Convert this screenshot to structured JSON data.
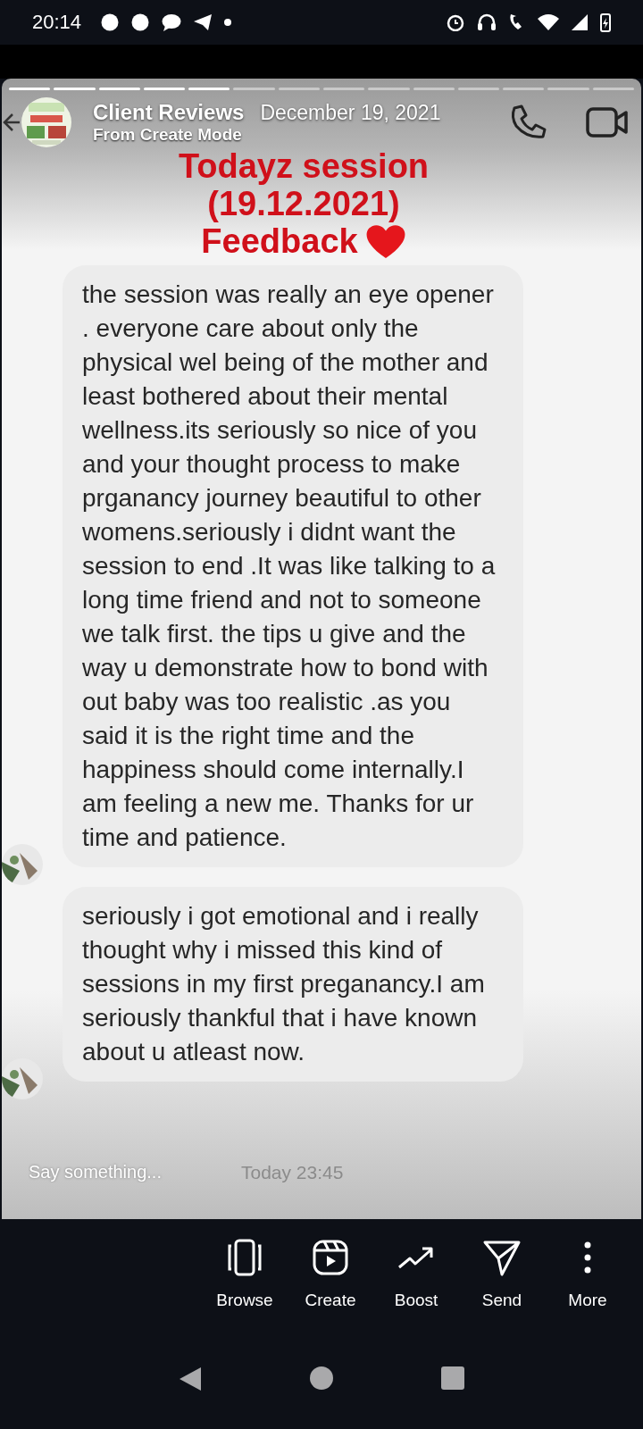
{
  "status_bar": {
    "time": "20:14"
  },
  "story_progress": [
    {
      "viewed": true
    },
    {
      "viewed": true
    },
    {
      "viewed": true
    },
    {
      "viewed": true
    },
    {
      "viewed": true
    },
    {
      "viewed": false
    },
    {
      "viewed": false
    },
    {
      "viewed": false
    },
    {
      "viewed": false
    },
    {
      "viewed": false
    },
    {
      "viewed": false
    },
    {
      "viewed": false
    },
    {
      "viewed": false
    },
    {
      "viewed": false
    }
  ],
  "chat_header": {
    "name": "Client Reviews",
    "subtitle": "From Create Mode",
    "date": "December 19, 2021"
  },
  "sticker": {
    "lines": [
      "Todayz session",
      "(19.12.2021)",
      "Feedback"
    ]
  },
  "messages": [
    {
      "text": "the session was really an eye opener . everyone care about only the physical wel being of the mother and least bothered about their mental wellness.its seriously so nice of you and your thought process to make prganancy journey beautiful to other womens.seriously i didnt want the session to end .It was like talking to a long time friend and not to someone we talk first. the tips u give and the way u demonstrate how to bond with out baby was too realistic .as you said it is the right time and the happiness should come internally.I am feeling a new me. Thanks for ur time and patience."
    },
    {
      "text": "seriously i got emotional and i really thought why i missed this kind of sessions in my first preganancy.I am seriously thankful that i have known about u atleast now."
    }
  ],
  "composer": {
    "placeholder": "Say something...",
    "timestamp": "Today 23:45"
  },
  "actions": [
    {
      "kind": "browse",
      "label": "Browse"
    },
    {
      "kind": "create",
      "label": "Create"
    },
    {
      "kind": "boost",
      "label": "Boost"
    },
    {
      "kind": "send",
      "label": "Send"
    },
    {
      "kind": "more",
      "label": "More"
    }
  ]
}
